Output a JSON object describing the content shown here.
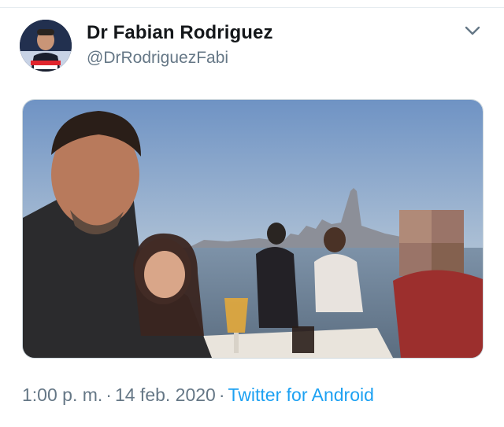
{
  "tweet": {
    "author": {
      "display_name": "Dr Fabian Rodriguez",
      "handle": "@DrRodriguezFabi",
      "avatar_icon": "profile-photo"
    },
    "menu_icon": "chevron-down-icon",
    "photo": {
      "description_icon": "selfie-photo"
    },
    "meta": {
      "time": "1:00 p. m.",
      "separator": "·",
      "date": "14 feb. 2020",
      "source": "Twitter for Android"
    }
  },
  "colors": {
    "name": "#14171a",
    "secondary": "#657786",
    "link": "#1da1f2"
  }
}
